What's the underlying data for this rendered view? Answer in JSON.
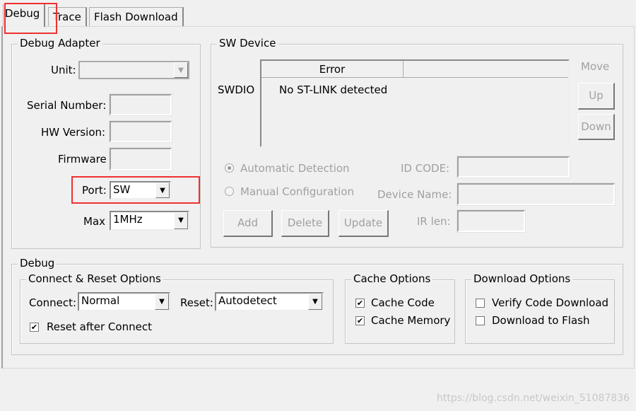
{
  "tabs": [
    {
      "label": "Debug",
      "active": true
    },
    {
      "label": "Trace"
    },
    {
      "label": "Flash Download"
    }
  ],
  "adapter": {
    "title": "Debug Adapter",
    "unit_label": "Unit:",
    "unit_value": "",
    "serial_label": "Serial Number:",
    "serial_value": "",
    "hw_label": "HW Version:",
    "hw_value": "",
    "fw_label": "Firmware",
    "fw_value": "",
    "port_label": "Port:",
    "port_value": "SW",
    "max_label": "Max",
    "max_value": "1MHz"
  },
  "sw_device": {
    "title": "SW Device",
    "swdio_label": "SWDIO",
    "columns": [
      "Error",
      ""
    ],
    "rows": [
      [
        "No ST-LINK detected",
        ""
      ]
    ],
    "move_label": "Move",
    "up": "Up",
    "down": "Down",
    "auto_label": "Automatic Detection",
    "manual_label": "Manual Configuration",
    "detection": "Automatic Detection",
    "id_code_label": "ID CODE:",
    "device_name_label": "Device Name:",
    "ir_len_label": "IR len:",
    "add": "Add",
    "delete": "Delete",
    "update": "Update"
  },
  "debug": {
    "title": "Debug",
    "connect_reset": {
      "title": "Connect & Reset Options",
      "connect_label": "Connect:",
      "connect_value": "Normal",
      "reset_label": "Reset:",
      "reset_value": "Autodetect",
      "reset_after_connect_label": "Reset after Connect",
      "reset_after_connect": true
    },
    "cache": {
      "title": "Cache Options",
      "cache_code_label": "Cache Code",
      "cache_code": true,
      "cache_memory_label": "Cache Memory",
      "cache_memory": true
    },
    "download": {
      "title": "Download Options",
      "verify_label": "Verify Code Download",
      "verify": false,
      "flash_label": "Download to Flash",
      "flash": false
    }
  },
  "highlight_color": "#f03030",
  "watermark": "https://blog.csdn.net/weixin_51087836"
}
